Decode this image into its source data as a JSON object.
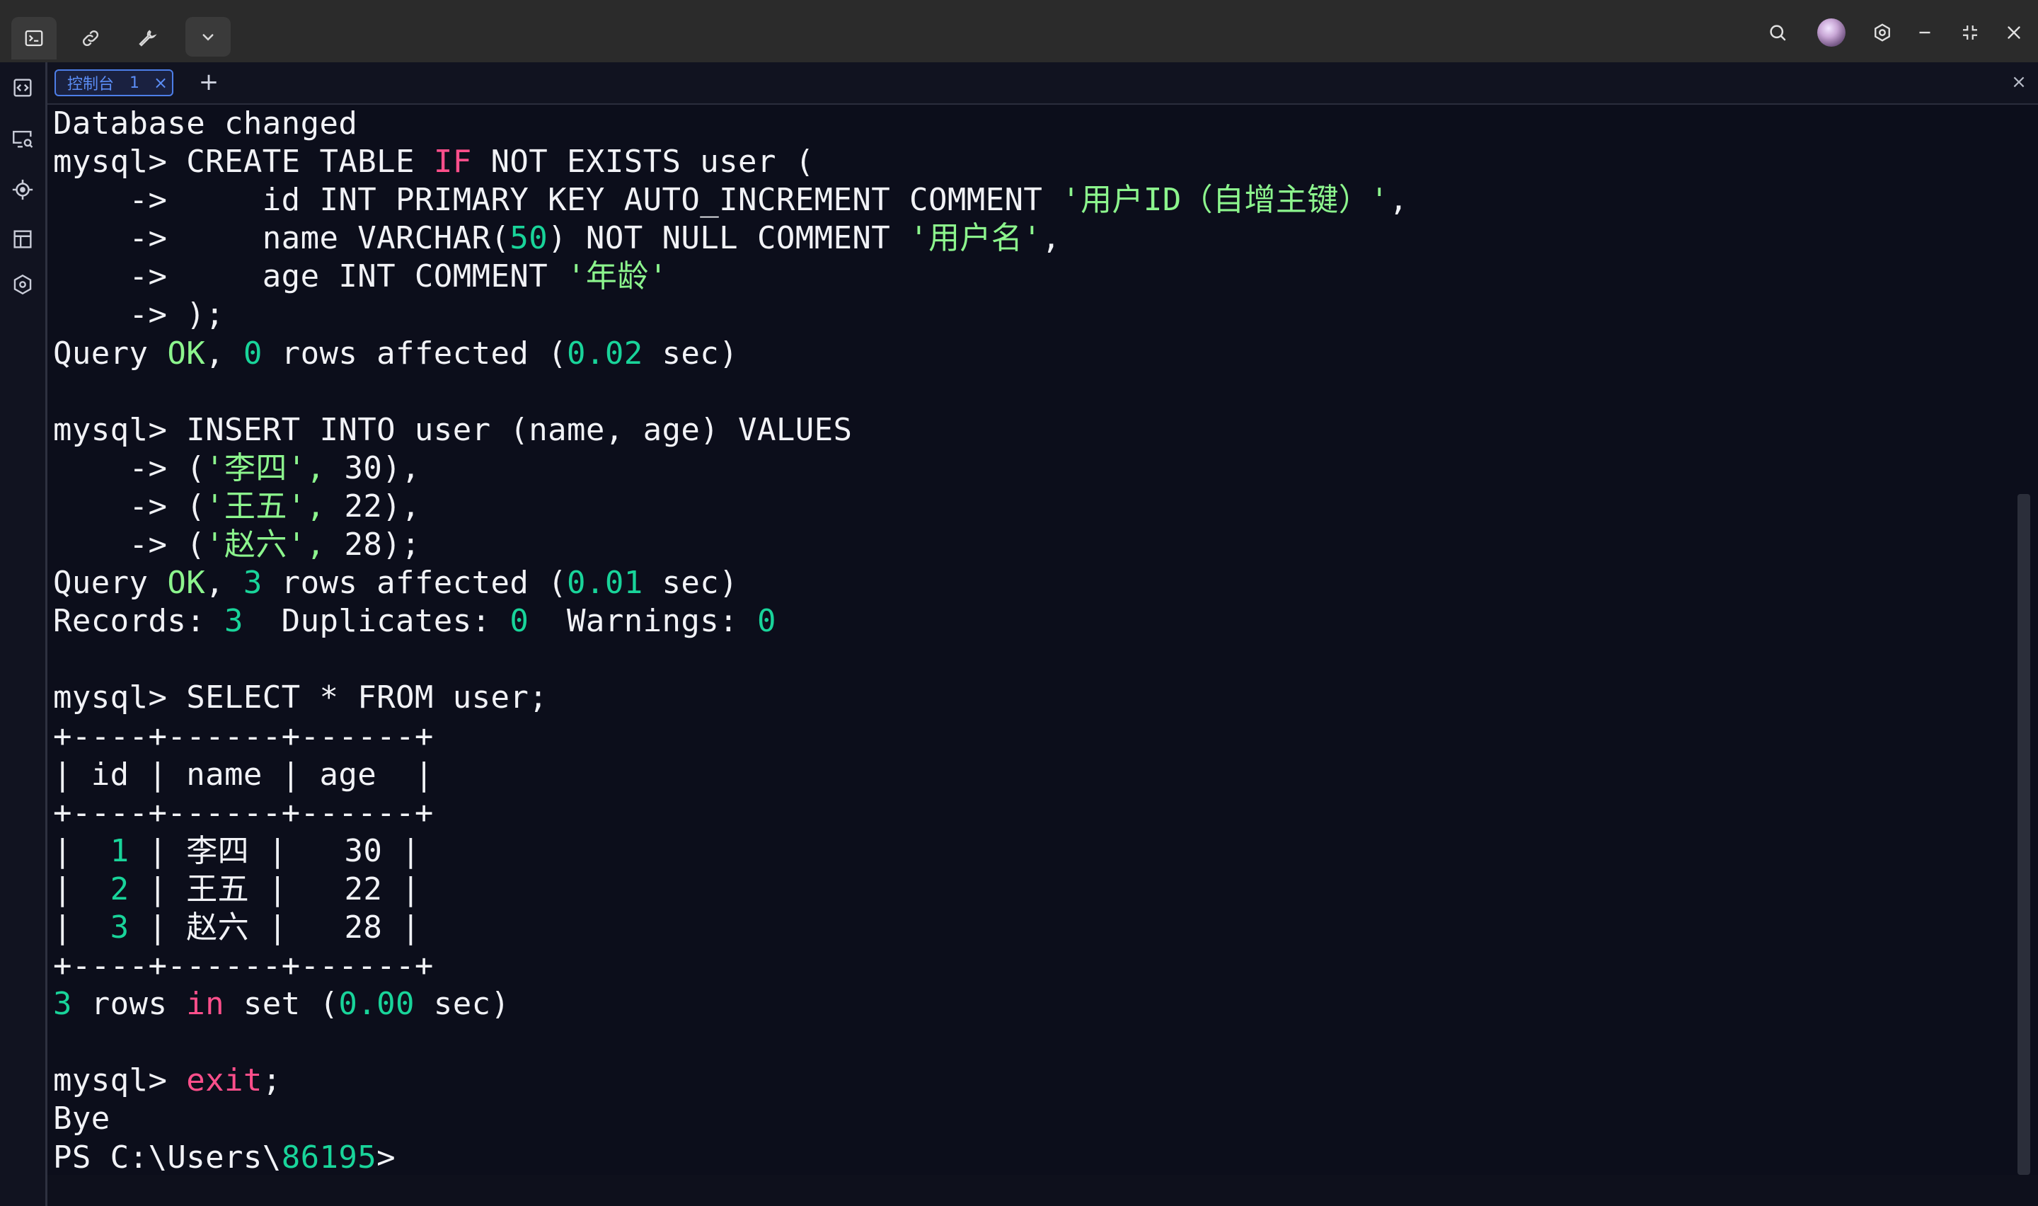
{
  "tabs": [
    {
      "label": "控制台",
      "number": "1",
      "close": "×"
    }
  ],
  "add_tab_label": "+",
  "close_panel_label": "×",
  "icons": {
    "titlebar_left": [
      "terminal-icon",
      "link-icon",
      "wrench-icon",
      "chevron-down-icon"
    ],
    "titlebar_right": [
      "search-icon",
      "avatar",
      "settings-icon",
      "minimize-icon",
      "restore-icon",
      "close-icon"
    ],
    "sidebar": [
      "code-file-icon",
      "monitor-search-icon",
      "crosshair-icon",
      "layout-icon",
      "hexagon-icon"
    ]
  },
  "colors": {
    "background": "#0c0e1b",
    "keyword": "#ff4f8b",
    "number": "#19d49a",
    "string": "#8cf58d",
    "tab_accent": "#4d7ee8"
  },
  "terminal": {
    "lines": [
      [
        {
          "t": "Database changed"
        }
      ],
      [
        {
          "t": "mysql> CREATE TABLE "
        },
        {
          "t": "IF",
          "c": "k"
        },
        {
          "t": " NOT EXISTS user ("
        }
      ],
      [
        {
          "t": "    ->     id INT PRIMARY KEY AUTO_INCREMENT COMMENT "
        },
        {
          "t": "'用户ID（自增主键）'",
          "c": "s"
        },
        {
          "t": ","
        }
      ],
      [
        {
          "t": "    ->     name VARCHAR("
        },
        {
          "t": "50",
          "c": "g"
        },
        {
          "t": ") NOT NULL COMMENT "
        },
        {
          "t": "'用户名'",
          "c": "s"
        },
        {
          "t": ","
        }
      ],
      [
        {
          "t": "    ->     age INT COMMENT "
        },
        {
          "t": "'年龄'",
          "c": "s"
        }
      ],
      [
        {
          "t": "    -> );"
        }
      ],
      [
        {
          "t": "Query "
        },
        {
          "t": "OK",
          "c": "s"
        },
        {
          "t": ", "
        },
        {
          "t": "0",
          "c": "g"
        },
        {
          "t": " rows affected ("
        },
        {
          "t": "0.02",
          "c": "g"
        },
        {
          "t": " sec)"
        }
      ],
      [
        {
          "t": ""
        }
      ],
      [
        {
          "t": "mysql> INSERT INTO user (name, age) VALUES"
        }
      ],
      [
        {
          "t": "    -> ("
        },
        {
          "t": "'李四',",
          "c": "s"
        },
        {
          "t": " 30),"
        }
      ],
      [
        {
          "t": "    -> ("
        },
        {
          "t": "'王五',",
          "c": "s"
        },
        {
          "t": " 22),"
        }
      ],
      [
        {
          "t": "    -> ("
        },
        {
          "t": "'赵六',",
          "c": "s"
        },
        {
          "t": " 28);"
        }
      ],
      [
        {
          "t": "Query "
        },
        {
          "t": "OK",
          "c": "s"
        },
        {
          "t": ", "
        },
        {
          "t": "3",
          "c": "g"
        },
        {
          "t": " rows affected ("
        },
        {
          "t": "0.01",
          "c": "g"
        },
        {
          "t": " sec)"
        }
      ],
      [
        {
          "t": "Records: "
        },
        {
          "t": "3",
          "c": "g"
        },
        {
          "t": "  Duplicates: "
        },
        {
          "t": "0",
          "c": "g"
        },
        {
          "t": "  Warnings: "
        },
        {
          "t": "0",
          "c": "g"
        }
      ],
      [
        {
          "t": ""
        }
      ],
      [
        {
          "t": "mysql> SELECT * FROM user;"
        }
      ],
      [
        {
          "t": "+----+------+------+"
        }
      ],
      [
        {
          "t": "| id | name | age  |"
        }
      ],
      [
        {
          "t": "+----+------+------+"
        }
      ],
      [
        {
          "t": "|  "
        },
        {
          "t": "1",
          "c": "g"
        },
        {
          "t": " | 李四 |   30 |"
        }
      ],
      [
        {
          "t": "|  "
        },
        {
          "t": "2",
          "c": "g"
        },
        {
          "t": " | 王五 |   22 |"
        }
      ],
      [
        {
          "t": "|  "
        },
        {
          "t": "3",
          "c": "g"
        },
        {
          "t": " | 赵六 |   28 |"
        }
      ],
      [
        {
          "t": "+----+------+------+"
        }
      ],
      [
        {
          "t": "3",
          "c": "g"
        },
        {
          "t": " rows "
        },
        {
          "t": "in",
          "c": "k"
        },
        {
          "t": " set ("
        },
        {
          "t": "0.00",
          "c": "g"
        },
        {
          "t": " sec)"
        }
      ],
      [
        {
          "t": ""
        }
      ],
      [
        {
          "t": "mysql> "
        },
        {
          "t": "exit",
          "c": "k"
        },
        {
          "t": ";"
        }
      ],
      [
        {
          "t": "Bye"
        }
      ],
      [
        {
          "t": "PS C:\\Users\\"
        },
        {
          "t": "86195",
          "c": "g"
        },
        {
          "t": ">"
        }
      ]
    ]
  }
}
